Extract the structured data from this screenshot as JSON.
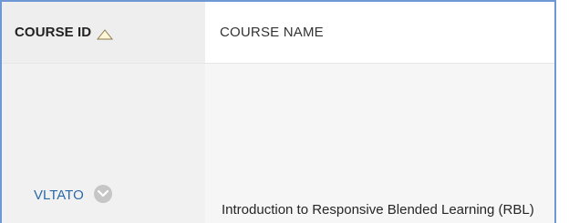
{
  "table": {
    "headers": {
      "course_id": "COURSE ID",
      "course_name": "COURSE NAME"
    },
    "sort_icon": "triangle-up-outline-icon",
    "rows": [
      {
        "course_id": "VLTATO",
        "course_name": "Introduction to Responsive Blended Learning (RBL)",
        "menu_icon": "chevron-down-icon"
      }
    ]
  },
  "colors": {
    "frame_border": "#6f97d6",
    "link": "#2b6aa8",
    "header_bg": "#eeeeee",
    "icon_gray": "#c6c6c6"
  }
}
